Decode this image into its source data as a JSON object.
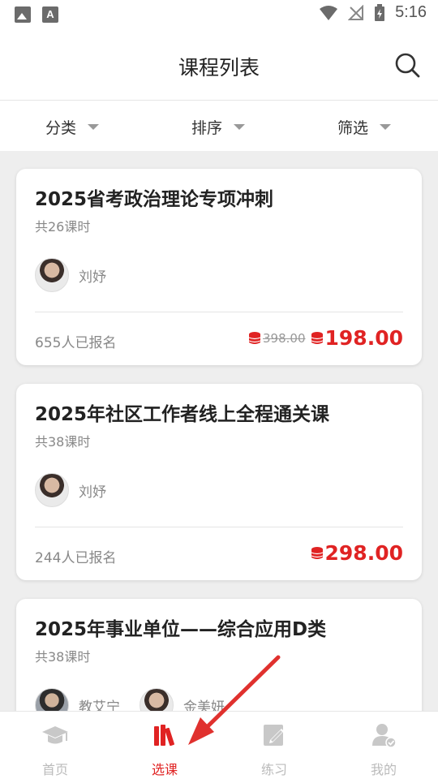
{
  "status_bar": {
    "time": "5:16"
  },
  "header": {
    "title": "课程列表"
  },
  "filters": [
    {
      "label": "分类"
    },
    {
      "label": "排序"
    },
    {
      "label": "筛选"
    }
  ],
  "courses": [
    {
      "title": "2025省考政治理论专项冲刺",
      "lessons": "共26课时",
      "teachers": [
        "刘妤"
      ],
      "enrolled": "655人已报名",
      "old_price": "398.00",
      "price": "198.00"
    },
    {
      "title": "2025年社区工作者线上全程通关课",
      "lessons": "共38课时",
      "teachers": [
        "刘妤"
      ],
      "enrolled": "244人已报名",
      "price": "298.00"
    },
    {
      "title": "2025年事业单位——综合应用D类",
      "lessons": "共38课时",
      "teachers": [
        "教艾宁",
        "金美妍"
      ]
    }
  ],
  "tabs": [
    {
      "label": "首页",
      "icon": "graduation-cap-icon"
    },
    {
      "label": "选课",
      "icon": "books-icon",
      "active": true
    },
    {
      "label": "练习",
      "icon": "edit-note-icon"
    },
    {
      "label": "我的",
      "icon": "user-check-icon"
    }
  ],
  "colors": {
    "accent": "#e02323",
    "muted": "#888888",
    "tab_inactive": "#bbbbbb"
  }
}
